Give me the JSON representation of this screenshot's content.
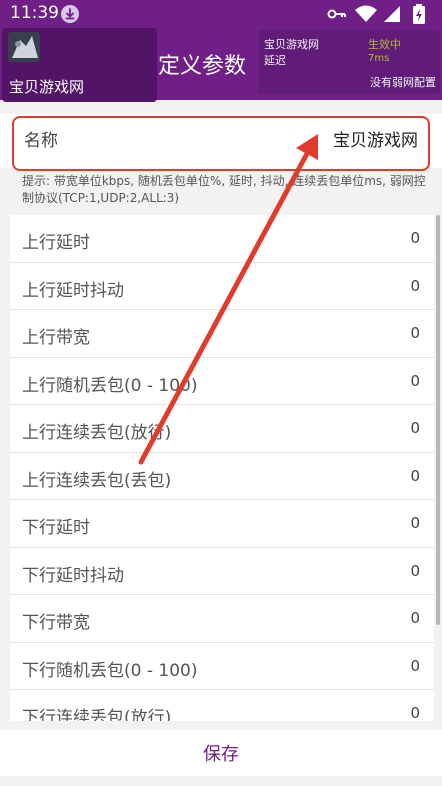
{
  "status_bar": {
    "time": "11:39",
    "icons": [
      "download-icon",
      "key-icon",
      "wifi-icon",
      "signal-icon",
      "battery-icon"
    ]
  },
  "app_bar": {
    "title": "点我自定义参数"
  },
  "overlay_left": {
    "label": "宝贝游戏网"
  },
  "overlay_right": {
    "network_name": "宝贝游戏网",
    "status": "生效中",
    "delay_label": "延迟",
    "delay_value": "7ms",
    "no_config": "没有弱网配置"
  },
  "name_row": {
    "label": "名称",
    "value": "宝贝游戏网"
  },
  "hint": "提示: 带宽单位kbps, 随机丢包单位%, 延时, 抖动, 连续丢包单位ms, 弱网控制协议(TCP:1,UDP:2,ALL:3)",
  "params": [
    {
      "label": "上行延时",
      "value": "0"
    },
    {
      "label": "上行延时抖动",
      "value": "0"
    },
    {
      "label": "上行带宽",
      "value": "0"
    },
    {
      "label": "上行随机丢包(0 - 100)",
      "value": "0"
    },
    {
      "label": "上行连续丢包(放行)",
      "value": "0"
    },
    {
      "label": "上行连续丢包(丢包)",
      "value": "0"
    },
    {
      "label": "下行延时",
      "value": "0"
    },
    {
      "label": "下行延时抖动",
      "value": "0"
    },
    {
      "label": "下行带宽",
      "value": "0"
    },
    {
      "label": "下行随机丢包(0 - 100)",
      "value": "0"
    },
    {
      "label": "下行连续丢包(放行)",
      "value": "0"
    }
  ],
  "save_label": "保存",
  "colors": {
    "app_purple": "#6f1f86",
    "annotation_red": "#e13b2b",
    "status_green": "#b6c43a"
  }
}
